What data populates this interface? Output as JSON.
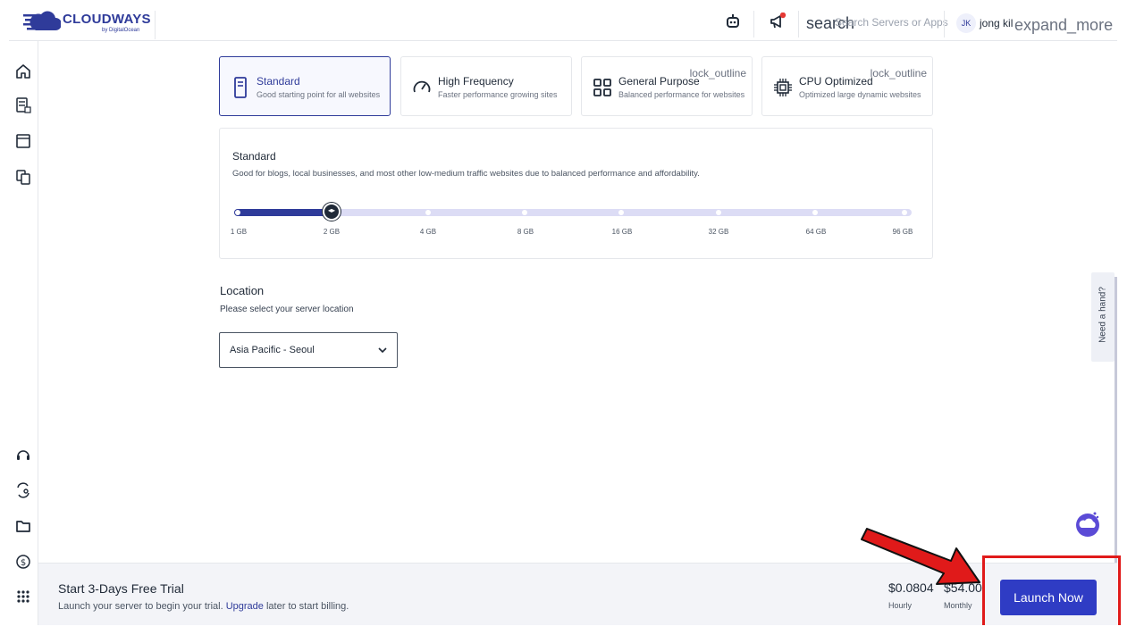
{
  "brand": {
    "name": "CLOUDWAYS",
    "sub": "by DigitalOcean"
  },
  "topbar": {
    "search_glyph": "search",
    "search_placeholder": "Search Servers or Apps",
    "user_initials": "JK",
    "user_name": "jong kil",
    "expand_glyph": "expand_more",
    "icons": [
      "bot-icon",
      "megaphone-icon",
      "search-icon",
      "avatar",
      "chevron-down-icon"
    ]
  },
  "sidebar": {
    "items": [
      "home-icon",
      "servers-icon",
      "applications-icon",
      "projects-icon",
      "support-icon",
      "team-icon",
      "files-icon",
      "billing-icon",
      "apps-grid-icon"
    ]
  },
  "server_types": [
    {
      "title": "Standard",
      "desc": "Good starting point for all websites",
      "selected": true,
      "lock": ""
    },
    {
      "title": "High Frequency",
      "desc": "Faster performance growing sites",
      "selected": false,
      "lock": ""
    },
    {
      "title": "General Purpose",
      "desc": "Balanced performance for websites",
      "selected": false,
      "lock": "lock_outline"
    },
    {
      "title": "CPU Optimized",
      "desc": "Optimized large dynamic websites",
      "selected": false,
      "lock": "lock_outline"
    }
  ],
  "size": {
    "title": "Standard",
    "desc": "Good for blogs, local businesses, and most other low-medium traffic websites due to balanced performance and affordability.",
    "options": [
      "1 GB",
      "2 GB",
      "4 GB",
      "8 GB",
      "16 GB",
      "32 GB",
      "64 GB",
      "96 GB"
    ],
    "selected_index": 1
  },
  "location": {
    "title": "Location",
    "desc": "Please select your server location",
    "selected": "Asia Pacific - Seoul"
  },
  "help_tab": "Need a hand?",
  "footer": {
    "trial_title": "Start 3-Days Free Trial",
    "trial_desc_before": "Launch your server to begin your trial.",
    "trial_link": "Upgrade",
    "trial_desc_after": "later to start billing.",
    "hourly_price": "$0.0804",
    "hourly_label": "Hourly",
    "monthly_price": "$54.00",
    "monthly_label": "Monthly",
    "launch_label": "Launch Now"
  },
  "colors": {
    "primary": "#2f3b9a",
    "button": "#2f3cc4",
    "track": "#dcdcf5",
    "highlight": "#e01a1a"
  }
}
